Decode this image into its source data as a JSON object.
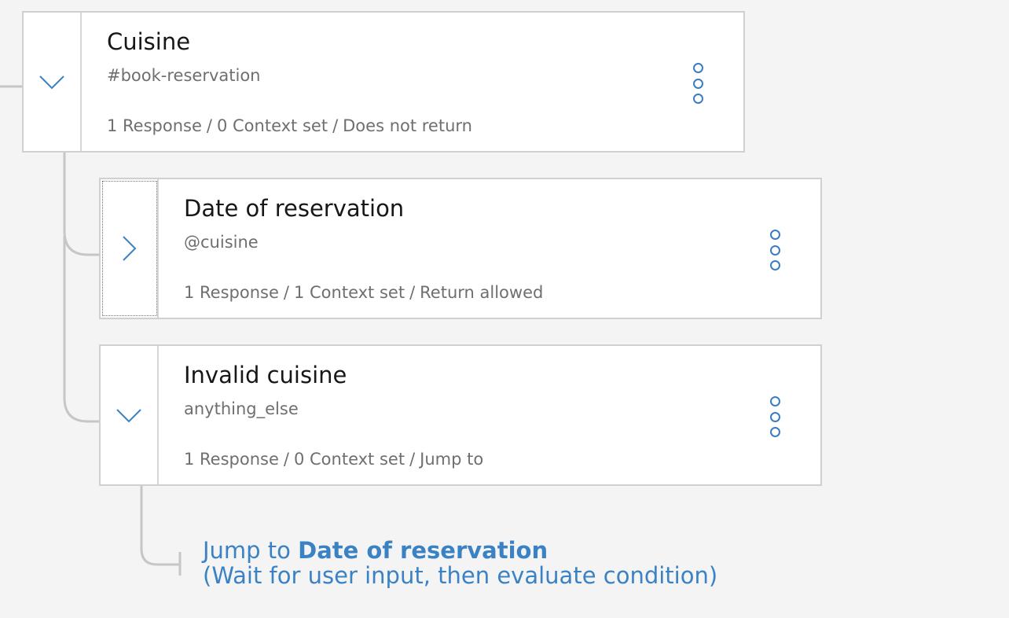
{
  "nodes": [
    {
      "title": "Cuisine",
      "condition": "#book-reservation",
      "responses": "1 Response",
      "context": "0 Context set",
      "return_behavior": "Does not return",
      "expanded": true
    },
    {
      "title": "Date of reservation",
      "condition": "@cuisine",
      "responses": "1 Response",
      "context": "1 Context set",
      "return_behavior": "Return allowed",
      "expanded": false
    },
    {
      "title": "Invalid cuisine",
      "condition": "anything_else",
      "responses": "1 Response",
      "context": "0 Context set",
      "return_behavior": "Jump to",
      "expanded": true
    }
  ],
  "separator": "/",
  "jump": {
    "prefix": "Jump to",
    "target": "Date of reservation",
    "detail": "(Wait for user input, then evaluate condition)"
  },
  "colors": {
    "accent": "#3b82c4",
    "background": "#f4f4f4",
    "card": "#ffffff",
    "connector": "#c6c6c6"
  },
  "icons": {
    "expanded": "chevron-down-icon",
    "collapsed": "chevron-right-icon",
    "menu": "overflow-menu-icon"
  }
}
